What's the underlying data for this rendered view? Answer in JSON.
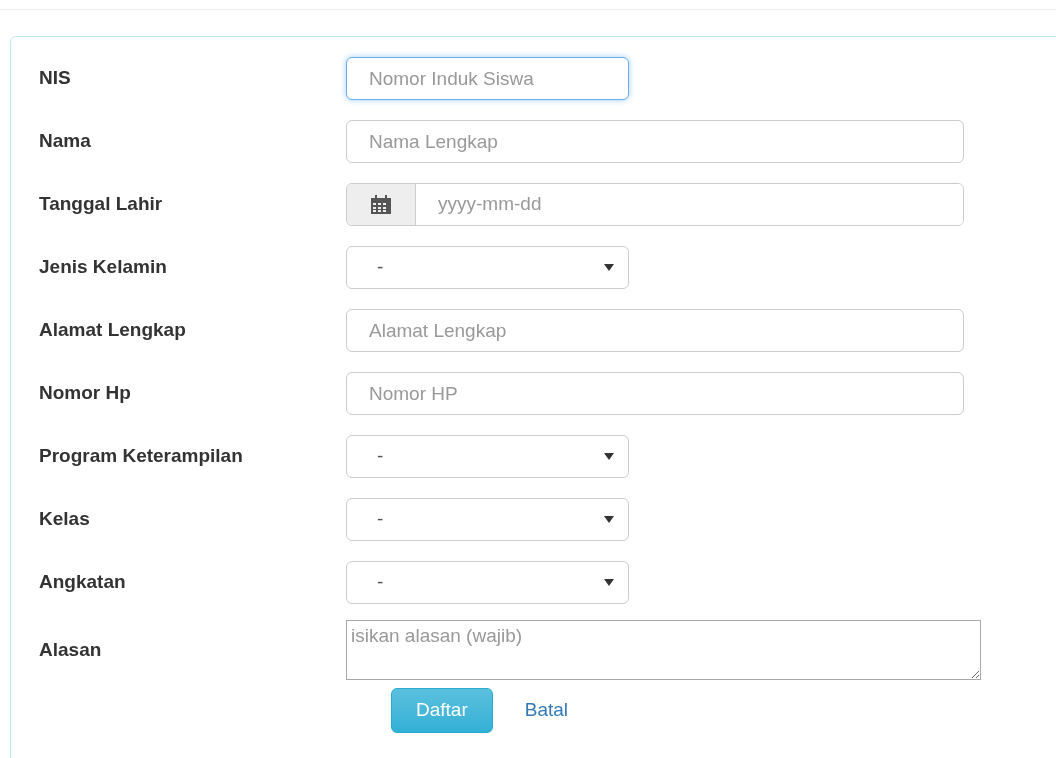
{
  "fields": [
    {
      "label": "NIS",
      "kind": "short",
      "placeholder": "Nomor Induk Siswa",
      "focused": true
    },
    {
      "label": "Nama",
      "kind": "text",
      "placeholder": "Nama Lengkap",
      "focused": false
    },
    {
      "label": "Tanggal Lahir",
      "kind": "date",
      "placeholder": "yyyy-mm-dd",
      "focused": false
    },
    {
      "label": "Jenis Kelamin",
      "kind": "select",
      "value": "-",
      "focused": false
    },
    {
      "label": "Alamat Lengkap",
      "kind": "text",
      "placeholder": "Alamat Lengkap",
      "focused": false
    },
    {
      "label": "Nomor Hp",
      "kind": "text",
      "placeholder": "Nomor HP",
      "focused": false
    },
    {
      "label": "Program Keterampilan",
      "kind": "select",
      "value": "-",
      "focused": false
    },
    {
      "label": "Kelas",
      "kind": "select",
      "value": "-",
      "focused": false
    },
    {
      "label": "Angkatan",
      "kind": "select",
      "value": "-",
      "focused": false
    },
    {
      "label": "Alasan",
      "kind": "textarea",
      "placeholder": "isikan alasan (wajib)",
      "focused": false
    }
  ],
  "buttons": {
    "submit": "Daftar",
    "cancel": "Batal"
  }
}
